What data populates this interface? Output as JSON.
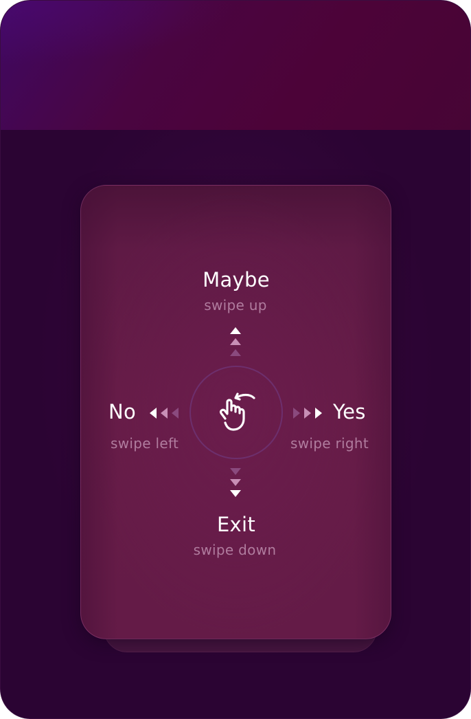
{
  "gestures": {
    "up": {
      "action": "Maybe",
      "hint": "swipe up"
    },
    "left": {
      "action": "No",
      "hint": "swipe left"
    },
    "right": {
      "action": "Yes",
      "hint": "swipe right"
    },
    "down": {
      "action": "Exit",
      "hint": "swipe down"
    }
  },
  "icons": {
    "center": "swipe-hand-icon",
    "arrow_up": "triple-arrow-up-icon",
    "arrow_down": "triple-arrow-down-icon",
    "arrow_left": "triple-arrow-left-icon",
    "arrow_right": "triple-arrow-right-icon"
  },
  "colors": {
    "background": "#2b0433",
    "header": "#4c0338",
    "card": "#641b47",
    "label": "#ffffff",
    "hint": "#b07c9e",
    "ring": "#6d2f6d"
  }
}
